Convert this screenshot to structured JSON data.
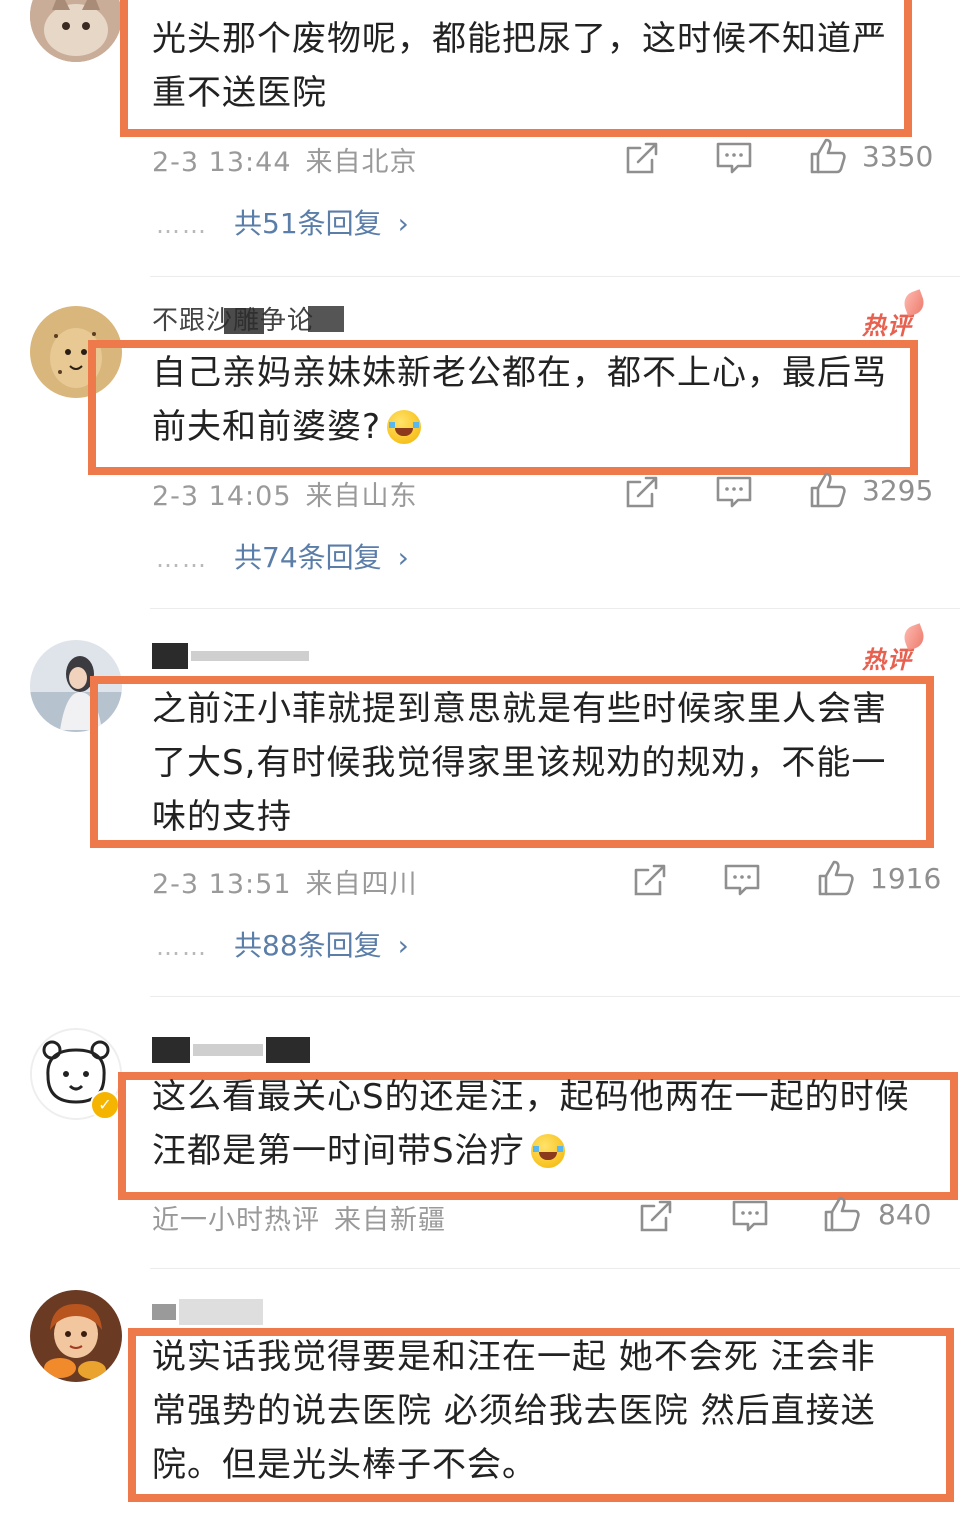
{
  "comments": [
    {
      "text": "光头那个废物呢，都能把尿了，这时候不知道严\n重不送医院",
      "time": "2-3 13:44",
      "location": "来自北京",
      "likes": "3350",
      "replies_label": "共51条回复",
      "hot_label": ""
    },
    {
      "username": "不跟沙雕争论",
      "text": "自己亲妈亲妹妹新老公都在，都不上心，最后骂\n前夫和前婆婆?",
      "time": "2-3 14:05",
      "location": "来自山东",
      "likes": "3295",
      "replies_label": "共74条回复",
      "hot_label": "热评"
    },
    {
      "text": "之前汪小菲就提到意思就是有些时候家里人会害\n了大S,有时候我觉得家里该规劝的规劝，不能一\n味的支持",
      "time": "2-3 13:51",
      "location": "来自四川",
      "likes": "1916",
      "replies_label": "共88条回复",
      "hot_label": "热评"
    },
    {
      "text": "这么看最关心S的还是汪，起码他两在一起的时候\n汪都是第一时间带S治疗",
      "time": "近一小时热评",
      "location": "来自新疆",
      "likes": "840"
    },
    {
      "text": "说实话我觉得要是和汪在一起 她不会死 汪会非\n常强势的说去医院 必须给我去医院 然后直接送\n院。但是光头棒子不会。"
    }
  ],
  "replies_more": "›",
  "reply_dots": "……",
  "colors": {
    "highlight_border": "#ee7a4b",
    "link_blue": "#5b7ea9",
    "meta_gray": "#9a9a9a",
    "hot_red": "#e8604f"
  },
  "icons": [
    "share-icon",
    "comment-icon",
    "like-thumb-icon",
    "chevron-right-icon",
    "verified-badge-icon"
  ]
}
